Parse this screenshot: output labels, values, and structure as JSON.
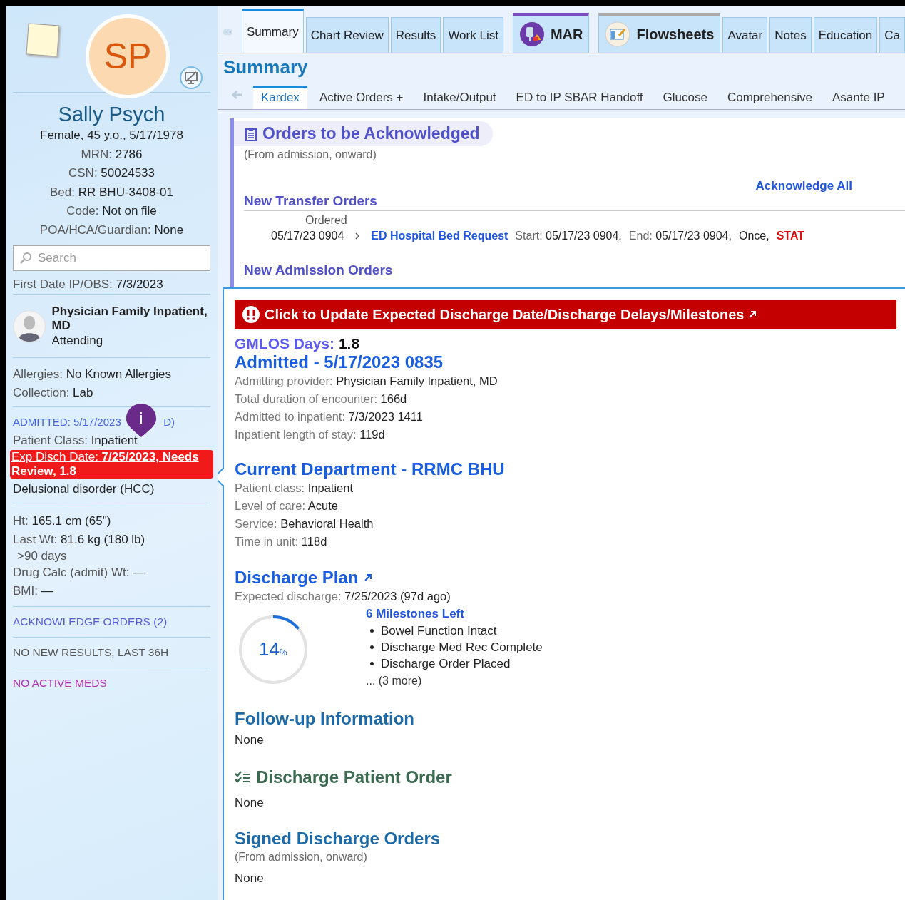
{
  "sidebar": {
    "initials": "SP",
    "name": "Sally Psych",
    "summary": "Female, 45 y.o., 5/17/1978",
    "details": [
      {
        "label": "MRN:",
        "value": "2786"
      },
      {
        "label": "CSN:",
        "value": "50024533"
      },
      {
        "label": "Bed:",
        "value": "RR BHU-3408-01"
      },
      {
        "label": "Code:",
        "value": "Not on file"
      },
      {
        "label": "POA/HCA/Guardian:",
        "value": "None"
      }
    ],
    "search": {
      "placeholder": "Search"
    },
    "first_date": {
      "label": "First Date IP/OBS:",
      "value": "7/3/2023"
    },
    "attending": {
      "name": "Physician Family Inpatient, MD",
      "role": "Attending"
    },
    "allergies": [
      {
        "label": "Allergies:",
        "value": "No Known Allergies"
      },
      {
        "label": "Collection:",
        "value": "Lab"
      }
    ],
    "admitted": {
      "text": "ADMITTED: 5/17/2023",
      "tail": "D)"
    },
    "marker": "i",
    "patient_class": {
      "label": "Patient Class:",
      "value": "Inpatient"
    },
    "exp_disch": "Exp Disch Date: **7/25/2023, Needs Review, 1.8**",
    "diagnosis": "Delusional disorder (HCC)",
    "measures": [
      {
        "label": "Ht:",
        "value": "165.1 cm (65\")"
      },
      {
        "label": "Last Wt:",
        "value": "81.6 kg (180 lb)",
        "note": ">90 days"
      },
      {
        "label": "Drug Calc (admit) Wt:",
        "value": "—"
      },
      {
        "label": "BMI:",
        "value": "—"
      }
    ],
    "links": [
      {
        "text": "ACKNOWLEDGE ORDERS (2)",
        "kind": "link"
      },
      {
        "text": "NO NEW RESULTS, LAST 36H",
        "kind": "plain"
      },
      {
        "text": "NO ACTIVE MEDS",
        "kind": "meds"
      }
    ]
  },
  "tabs": [
    {
      "label": "Summary",
      "selected": true,
      "kind": "plain"
    },
    {
      "label": "Chart Review",
      "selected": false,
      "kind": "plain"
    },
    {
      "label": "Results",
      "selected": false,
      "kind": "plain"
    },
    {
      "label": "Work List",
      "selected": false,
      "kind": "plain"
    },
    {
      "label": "MAR",
      "selected": false,
      "kind": "mar"
    },
    {
      "label": "Flowsheets",
      "selected": false,
      "kind": "flowsheets"
    },
    {
      "label": "Avatar",
      "selected": false,
      "kind": "plain"
    },
    {
      "label": "Notes",
      "selected": false,
      "kind": "plain"
    },
    {
      "label": "Education",
      "selected": false,
      "kind": "plain"
    },
    {
      "label": "Ca",
      "selected": false,
      "kind": "plain"
    }
  ],
  "page_title": "Summary",
  "subtabs": [
    {
      "label": "Kardex",
      "selected": true
    },
    {
      "label": "Active Orders +",
      "selected": false
    },
    {
      "label": "Intake/Output",
      "selected": false
    },
    {
      "label": "ED to IP SBAR Handoff",
      "selected": false
    },
    {
      "label": "Glucose",
      "selected": false
    },
    {
      "label": "Comprehensive",
      "selected": false
    },
    {
      "label": "Asante IP",
      "selected": false
    }
  ],
  "orders": {
    "title": "Orders to be Acknowledged",
    "subtitle": "(From admission, onward)",
    "action": "Acknowledge All",
    "group": "New Transfer Orders",
    "column": "Ordered",
    "rows": [
      {
        "ordered": "05/17/23 0904",
        "name": "ED Hospital Bed Request",
        "start_label": "Start:",
        "start": "05/17/23 0904,",
        "end_label": "End:",
        "end": "05/17/23 0904,",
        "frequency": "Once,",
        "priority": "STAT"
      }
    ],
    "next_group": "New Admission Orders"
  },
  "popup": {
    "banner": "Click to Update Expected Discharge Date/Discharge Delays/Milestones",
    "gmlos": {
      "label": "GMLOS Days:",
      "value": "1.8"
    },
    "admitted": {
      "title": "Admitted - 5/17/2023 0835",
      "fields": [
        {
          "label": "Admitting provider:",
          "value": "Physician Family Inpatient, MD"
        },
        {
          "label": "Total duration of encounter:",
          "value": "166d"
        },
        {
          "label": "Admitted to inpatient:",
          "value": "7/3/2023 1411"
        },
        {
          "label": "Inpatient length of stay:",
          "value": "119d"
        }
      ]
    },
    "department": {
      "title": "Current Department - RRMC BHU",
      "fields": [
        {
          "label": "Patient class:",
          "value": "Inpatient"
        },
        {
          "label": "Level of care:",
          "value": "Acute"
        },
        {
          "label": "Service:",
          "value": "Behavioral Health"
        },
        {
          "label": "Time in unit:",
          "value": "118d"
        }
      ]
    },
    "discharge_plan": {
      "title": "Discharge Plan",
      "expected": {
        "label": "Expected discharge:",
        "value": "7/25/2023 (97d ago)"
      },
      "progress": {
        "level": 0.14,
        "value": "14",
        "unit": "%"
      },
      "milestones_title": "6 Milestones Left",
      "milestones": [
        "Bowel Function Intact",
        "Discharge Med Rec Complete",
        "Discharge Order Placed"
      ],
      "more": "... (3 more)"
    },
    "followup": {
      "title": "Follow-up Information",
      "value": "None"
    },
    "discharge_order": {
      "title": "Discharge Patient Order",
      "value": "None"
    },
    "signed": {
      "title": "Signed Discharge Orders",
      "subtitle": "(From admission, onward)",
      "value": "None"
    }
  }
}
